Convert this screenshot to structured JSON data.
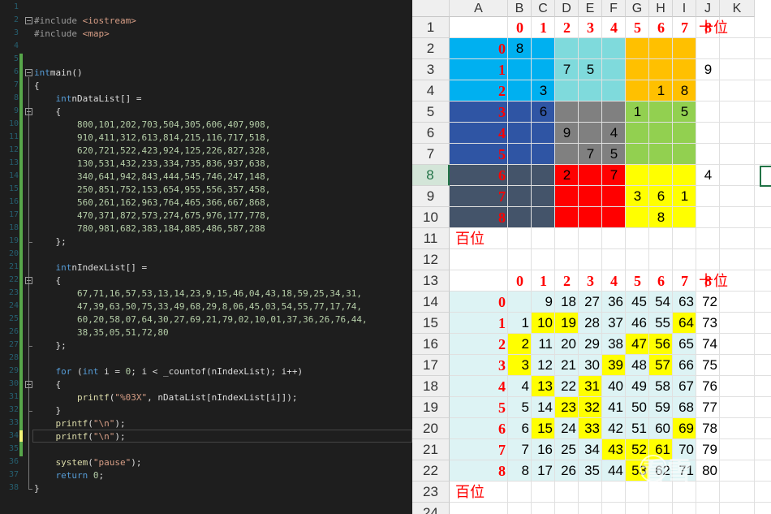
{
  "editor": {
    "line_numbers": [
      "1",
      "2",
      "3",
      "4",
      "5",
      "6",
      "7",
      "8",
      "9",
      "10",
      "11",
      "12",
      "13",
      "14",
      "15",
      "16",
      "17",
      "18",
      "19",
      "20",
      "21",
      "22",
      "23",
      "24",
      "25",
      "26",
      "27",
      "28",
      "29",
      "30",
      "31",
      "32",
      "33",
      "34",
      "35",
      "36",
      "37",
      "38"
    ],
    "lines": [
      [],
      [
        [
          "pp",
          "#include "
        ],
        [
          "str",
          "<iostream>"
        ]
      ],
      [
        [
          "pp",
          "#include "
        ],
        [
          "str",
          "<map>"
        ]
      ],
      [],
      [],
      [
        [
          "kw",
          "int"
        ],
        [
          "",
          "main()"
        ]
      ],
      [
        [
          "",
          "{"
        ]
      ],
      [
        [
          "",
          "    "
        ],
        [
          "kw",
          "int"
        ],
        [
          "",
          "nDataList[] ="
        ]
      ],
      [
        [
          "",
          "    {"
        ]
      ],
      [
        [
          "",
          "        "
        ],
        [
          "num",
          "800,101,202,703,504,305,606,407,908,"
        ]
      ],
      [
        [
          "",
          "        "
        ],
        [
          "num",
          "910,411,312,613,814,215,116,717,518,"
        ]
      ],
      [
        [
          "",
          "        "
        ],
        [
          "num",
          "620,721,522,423,924,125,226,827,328,"
        ]
      ],
      [
        [
          "",
          "        "
        ],
        [
          "num",
          "130,531,432,233,334,735,836,937,638,"
        ]
      ],
      [
        [
          "",
          "        "
        ],
        [
          "num",
          "340,641,942,843,444,545,746,247,148,"
        ]
      ],
      [
        [
          "",
          "        "
        ],
        [
          "num",
          "250,851,752,153,654,955,556,357,458,"
        ]
      ],
      [
        [
          "",
          "        "
        ],
        [
          "num",
          "560,261,162,963,764,465,366,667,868,"
        ]
      ],
      [
        [
          "",
          "        "
        ],
        [
          "num",
          "470,371,872,573,274,675,976,177,778,"
        ]
      ],
      [
        [
          "",
          "        "
        ],
        [
          "num",
          "780,981,682,383,184,885,486,587,288"
        ]
      ],
      [
        [
          "",
          "    };"
        ]
      ],
      [],
      [
        [
          "",
          "    "
        ],
        [
          "kw",
          "int"
        ],
        [
          "",
          "nIndexList[] ="
        ]
      ],
      [
        [
          "",
          "    {"
        ]
      ],
      [
        [
          "",
          "        "
        ],
        [
          "num",
          "67,71,16,57,53,13,14,23,9,15,46,04,43,18,59,25,34,31,"
        ]
      ],
      [
        [
          "",
          "        "
        ],
        [
          "num",
          "47,39,63,50,75,33,49,68,29,8,06,45,03,54,55,77,17,74,"
        ]
      ],
      [
        [
          "",
          "        "
        ],
        [
          "num",
          "60,20,58,07,64,30,27,69,21,79,02,10,01,37,36,26,76,44,"
        ]
      ],
      [
        [
          "",
          "        "
        ],
        [
          "num",
          "38,35,05,51,72,80"
        ]
      ],
      [
        [
          "",
          "    };"
        ]
      ],
      [],
      [
        [
          "",
          "    "
        ],
        [
          "kw",
          "for"
        ],
        [
          "",
          " ("
        ],
        [
          "kw",
          "int"
        ],
        [
          "",
          " i = "
        ],
        [
          "num",
          "0"
        ],
        [
          "",
          "; i < _countof(nIndexList); i++)"
        ]
      ],
      [
        [
          "",
          "    {"
        ]
      ],
      [
        [
          "",
          "        "
        ],
        [
          "fn",
          "printf"
        ],
        [
          "",
          "("
        ],
        [
          "str",
          "\"%03X\""
        ],
        [
          "",
          ", nDataList[nIndexList[i]]);"
        ]
      ],
      [
        [
          "",
          "    }"
        ]
      ],
      [
        [
          "",
          "    "
        ],
        [
          "fn",
          "printf"
        ],
        [
          "",
          "("
        ],
        [
          "str",
          "\"\\n\""
        ],
        [
          "",
          ");"
        ]
      ],
      [
        [
          "",
          "    "
        ],
        [
          "fn",
          "printf"
        ],
        [
          "",
          "("
        ],
        [
          "str",
          "\"\\n\""
        ],
        [
          "",
          ");"
        ]
      ],
      [],
      [
        [
          "",
          "    "
        ],
        [
          "fn",
          "system"
        ],
        [
          "",
          "("
        ],
        [
          "str",
          "\"pause\""
        ],
        [
          "",
          ");"
        ]
      ],
      [
        [
          "",
          "    "
        ],
        [
          "kw",
          "return"
        ],
        [
          "",
          " "
        ],
        [
          "num",
          "0"
        ],
        [
          "",
          ";"
        ]
      ],
      [
        [
          "",
          "}"
        ]
      ]
    ]
  },
  "sheet": {
    "columns": [
      "A",
      "B",
      "C",
      "D",
      "E",
      "F",
      "G",
      "H",
      "I",
      "J",
      "K"
    ],
    "rows": [
      "1",
      "2",
      "3",
      "4",
      "5",
      "6",
      "7",
      "8",
      "9",
      "10",
      "11",
      "12",
      "13",
      "14",
      "15",
      "16",
      "17",
      "18",
      "19",
      "20",
      "21",
      "22",
      "23",
      "24"
    ],
    "digits": [
      "0",
      "1",
      "2",
      "3",
      "4",
      "5",
      "6",
      "7",
      "8"
    ],
    "caption_tens": "十位",
    "caption_hundreds": "百位",
    "grid1_values": [
      [
        "8",
        "",
        "",
        "",
        "",
        "",
        "",
        "",
        ""
      ],
      [
        "",
        "",
        "7",
        "5",
        "",
        "",
        "",
        "",
        "9"
      ],
      [
        "",
        "3",
        "",
        "",
        "",
        "",
        "1",
        "8",
        ""
      ],
      [
        "",
        "6",
        "",
        "",
        "",
        "1",
        "",
        "5",
        ""
      ],
      [
        "",
        "",
        "9",
        "",
        "4",
        "",
        "",
        "",
        ""
      ],
      [
        "",
        "",
        "",
        "7",
        "5",
        "",
        "",
        "",
        ""
      ],
      [
        "",
        "",
        "2",
        "",
        "7",
        "",
        "",
        "",
        "4"
      ],
      [
        "",
        "",
        "",
        "",
        "",
        "3",
        "6",
        "1",
        ""
      ],
      [
        "",
        "",
        "",
        "",
        "",
        "",
        "8",
        "",
        ""
      ]
    ],
    "grid2_values": [
      [
        "",
        "9",
        "18",
        "27",
        "36",
        "45",
        "54",
        "63",
        "72"
      ],
      [
        "1",
        "10",
        "19",
        "28",
        "37",
        "46",
        "55",
        "64",
        "73"
      ],
      [
        "2",
        "11",
        "20",
        "29",
        "38",
        "47",
        "56",
        "65",
        "74"
      ],
      [
        "3",
        "12",
        "21",
        "30",
        "39",
        "48",
        "57",
        "66",
        "75"
      ],
      [
        "4",
        "13",
        "22",
        "31",
        "40",
        "49",
        "58",
        "67",
        "76"
      ],
      [
        "5",
        "14",
        "23",
        "32",
        "41",
        "50",
        "59",
        "68",
        "77"
      ],
      [
        "6",
        "15",
        "24",
        "33",
        "42",
        "51",
        "60",
        "69",
        "78"
      ],
      [
        "7",
        "16",
        "25",
        "34",
        "43",
        "52",
        "61",
        "70",
        "79"
      ],
      [
        "8",
        "17",
        "26",
        "35",
        "44",
        "53",
        "62",
        "71",
        "80"
      ]
    ],
    "grid2_highlighted": [
      [
        1,
        2
      ],
      [
        1,
        3
      ],
      [
        1,
        8
      ],
      [
        2,
        1
      ],
      [
        2,
        6
      ],
      [
        2,
        7
      ],
      [
        3,
        1
      ],
      [
        3,
        5
      ],
      [
        3,
        7
      ],
      [
        4,
        2
      ],
      [
        4,
        4
      ],
      [
        5,
        3
      ],
      [
        5,
        4
      ],
      [
        6,
        2
      ],
      [
        6,
        4
      ],
      [
        6,
        8
      ],
      [
        7,
        5
      ],
      [
        7,
        6
      ],
      [
        7,
        7
      ],
      [
        8,
        6
      ]
    ],
    "block_colors": [
      [
        "#00b0f0",
        "#7fdadc",
        "#ffc000"
      ],
      [
        "#2f55a4",
        "#808080",
        "#92d050"
      ],
      [
        "#44546a",
        "#ff0000",
        "#ffff00"
      ]
    ],
    "grid2_background": "#ddf3f4",
    "highlight_color": "#ffff00",
    "header_color": "#ff0000",
    "selected_row": "8"
  },
  "watermark": "看雪"
}
